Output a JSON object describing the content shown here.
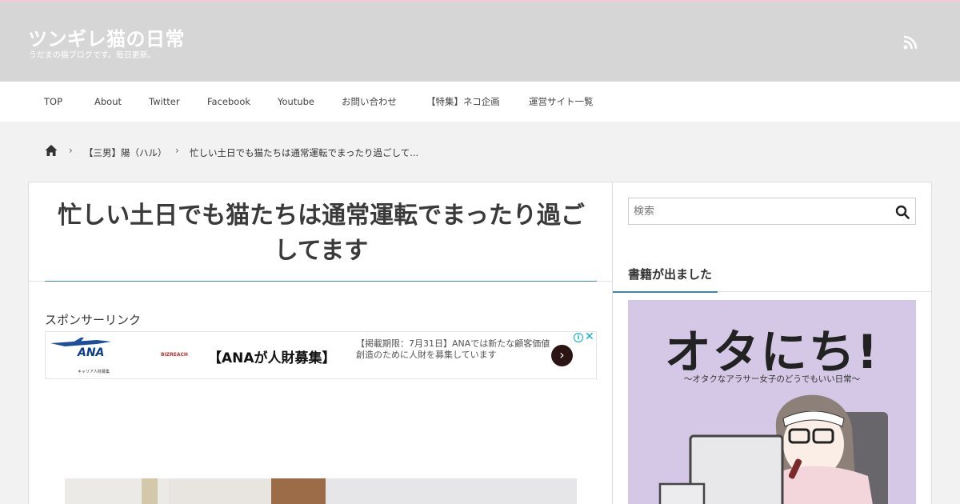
{
  "header": {
    "site_title": "ツンギレ猫の日常",
    "site_desc": "うだまの猫ブログです。毎日更新。",
    "rss_icon": "rss-icon",
    "colors": {
      "header_bg": "#d6d6d6",
      "top_border": "#f3c9d6",
      "accent": "#3d8aa3"
    }
  },
  "nav": {
    "items": [
      "TOP",
      "About",
      "Twitter",
      "Facebook",
      "Youtube",
      "お問い合わせ",
      "【特集】ネコ企画",
      "運営サイト一覧"
    ]
  },
  "breadcrumb": {
    "home_icon": "home-icon",
    "items": [
      "【三男】陽（ハル）",
      "忙しい土日でも猫たちは通常運転でまったり過ごして..."
    ]
  },
  "post": {
    "title_line1": "忙しい土日でも猫たちは通常運転でまったり過ご",
    "title_line2": "してます",
    "sponsor_label": "スポンサーリンク"
  },
  "ad": {
    "logo": "ANA",
    "tagline": "キャリア人財募集",
    "tiny": "BIZREACH",
    "headline": "【ANAが人財募集】",
    "body": "【掲載期限：7月31日】ANAでは新たな顧客価値創造のために人財を募集しています",
    "info_glyph": "i",
    "close_glyph": "✕",
    "arrow_glyph": "›"
  },
  "sidebar": {
    "search_placeholder": "検索",
    "widget_title": "書籍が出ました",
    "book_title": "オタにち!",
    "book_subtitle": "～オタクなアラサー女子のどうでもいい日常～"
  }
}
